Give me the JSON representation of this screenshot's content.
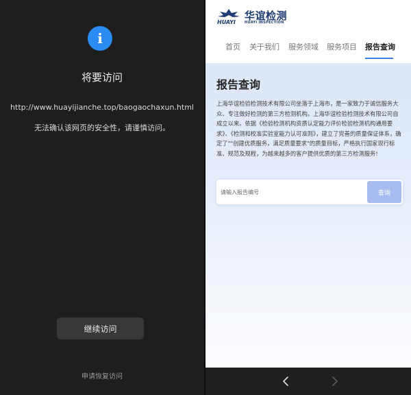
{
  "warning": {
    "icon": "info-icon",
    "icon_glyph": "i",
    "title": "将要访问",
    "url": "http://www.huayijianche.top/baogaochaxun.html",
    "note": "无法确认该网页的安全性，请谨慎访问。",
    "continue_label": "继续访问",
    "restore_label": "申请恢复访问"
  },
  "site": {
    "logo_cn": "华谊检测",
    "logo_en": "HUAYI INSPECTION",
    "logo_mark_text": "HUAYI",
    "nav": [
      {
        "label": "首页"
      },
      {
        "label": "关于我们"
      },
      {
        "label": "服务领域"
      },
      {
        "label": "服务项目"
      },
      {
        "label": "报告查询",
        "active": true
      }
    ],
    "page_title": "报告查询",
    "intro": "上海华谊检验检测技术有限公司坐落于上海市，是一家致力于诚信服务大众、专注做好检测的第三方检测机构。上海华谊检验检测技术有限公司自成立以来。依据《检验检测机构资质认定能力评价检验检测机构通用要求》、《检测和校准实验室能力认可准则》，建立了完善的质量保证体系，确定了\"\"创建优质服务，满足质量要求\"的质量目标，严格执行国家现行标准、规范及规程，为越来越多的客户提供优质的第三方检测服务!",
    "search_placeholder": "请输入报告编号",
    "search_button": "查询"
  },
  "toolbar": {
    "back_icon": "chevron-left-icon",
    "forward_icon": "chevron-right-icon"
  },
  "colors": {
    "accent": "#2a8bf2",
    "brand_navy": "#1f3b73",
    "nav_underline": "#3b7de0",
    "search_button": "#a7bcef"
  }
}
